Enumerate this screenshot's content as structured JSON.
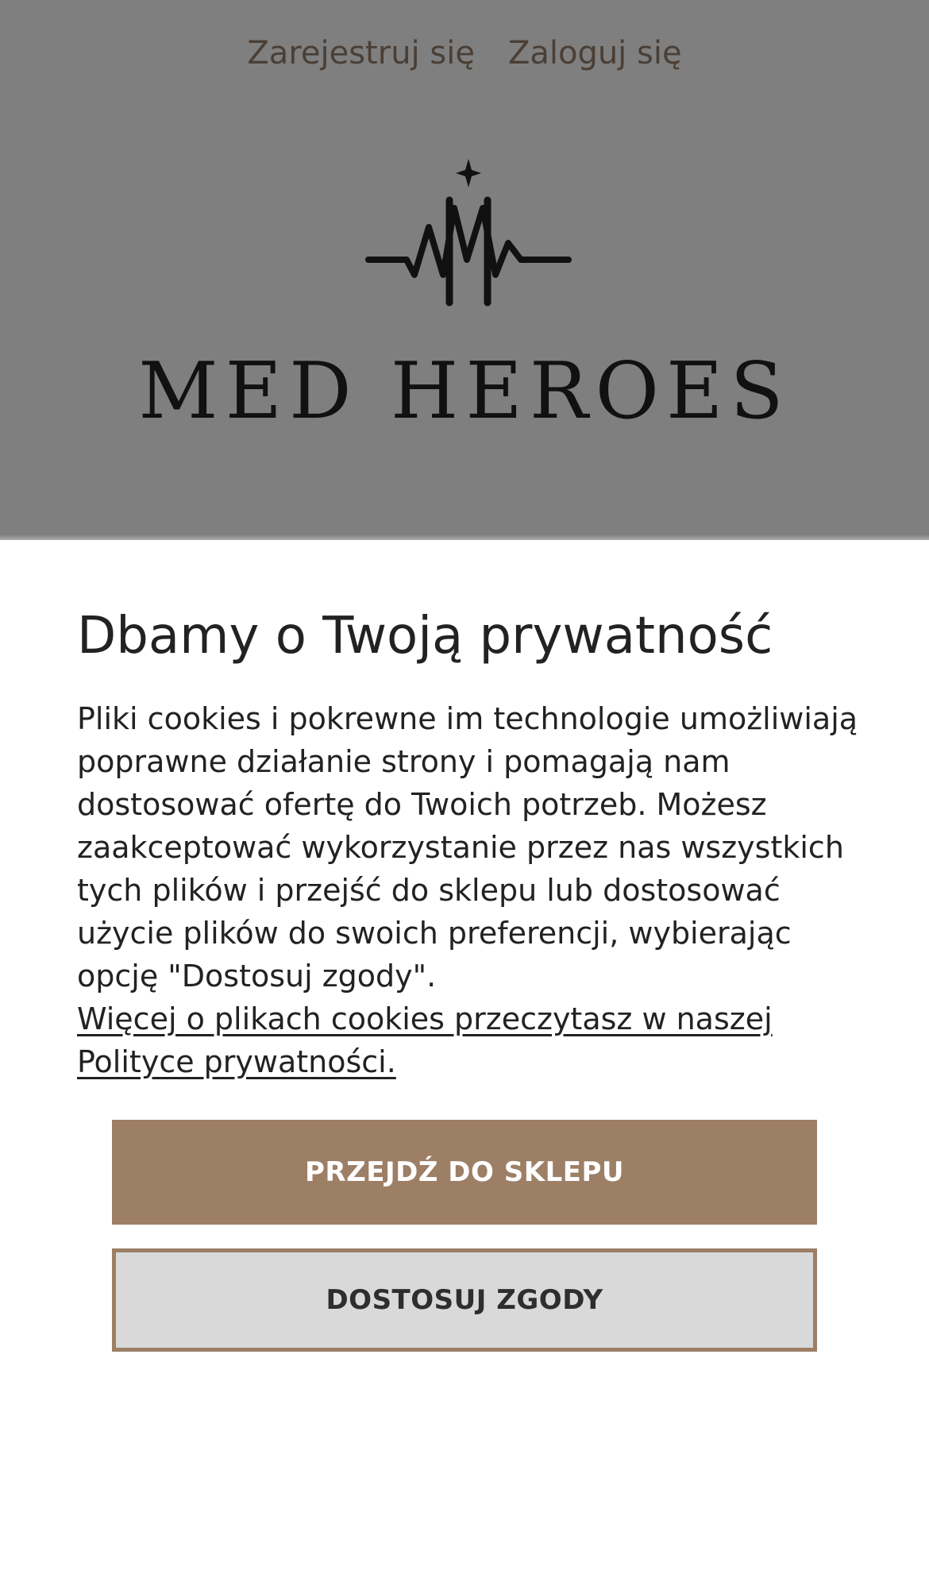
{
  "header": {
    "register_link": "Zarejestruj się",
    "login_link": "Zaloguj się",
    "logo_text": "MED HEROES"
  },
  "consent": {
    "title": "Dbamy o Twoją prywatność",
    "body": "Pliki cookies i pokrewne im technologie umożliwiają poprawne działanie strony i pomagają nam dostosować ofertę do Twoich potrzeb. Możesz zaakceptować wykorzystanie przez nas wszystkich tych plików i przejść do sklepu lub dostosować użycie plików do swoich preferencji, wybierając opcję \"Dostosuj zgody\".",
    "policy_link": "Więcej o plikach cookies przeczytasz w naszej Polityce prywatności.",
    "accept_button": "PRZEJDŹ DO SKLEPU",
    "customize_button": "DOSTOSUJ ZGODY"
  },
  "colors": {
    "overlay": "#7f7f7f",
    "accent": "#9d7f66",
    "secondary_button_bg": "#d9d9d9",
    "text": "#222222"
  },
  "icons": {
    "logo": "heartbeat-star-logo-icon"
  }
}
